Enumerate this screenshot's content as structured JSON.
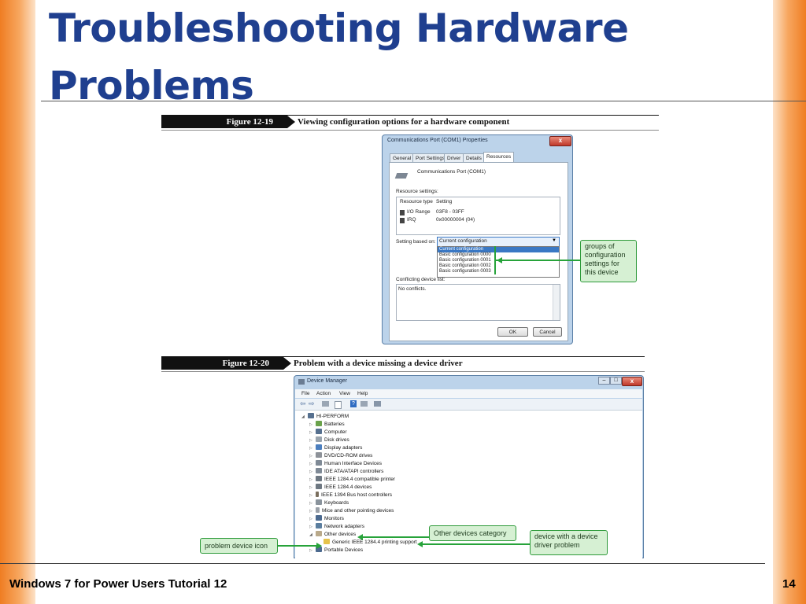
{
  "slide": {
    "title": "Troubleshooting Hardware Problems",
    "footer": "Windows 7 for Power Users Tutorial 12",
    "page_number": "14"
  },
  "figure1": {
    "label": "Figure 12-19",
    "caption": "Viewing configuration options for a hardware component",
    "window": {
      "title": "Communications Port (COM1) Properties",
      "close_label": "x",
      "tabs": [
        "General",
        "Port Settings",
        "Driver",
        "Details",
        "Resources"
      ],
      "active_tab": "Resources",
      "device_name": "Communications Port (COM1)",
      "resource_settings_label": "Resource settings:",
      "table_headers": [
        "Resource type",
        "Setting"
      ],
      "table_rows": [
        {
          "type": "I/O Range",
          "setting": "03F8 - 03FF"
        },
        {
          "type": "IRQ",
          "setting": "0x00000004 (04)"
        }
      ],
      "setting_based_on_label": "Setting based on:",
      "selected_config": "Current configuration",
      "config_options": [
        "Current configuration",
        "Basic configuration 0000",
        "Basic configuration 0001",
        "Basic configuration 0002",
        "Basic configuration 0003"
      ],
      "conflicting_label": "Conflicting device list:",
      "conflicts_text": "No conflicts.",
      "ok_label": "OK",
      "cancel_label": "Cancel"
    },
    "callout": "groups of configuration settings for this device"
  },
  "figure2": {
    "label": "Figure 12-20",
    "caption": "Problem with a device missing a device driver",
    "window": {
      "title": "Device Manager",
      "menu": [
        "File",
        "Action",
        "View",
        "Help"
      ],
      "root": "HI-PERFORM",
      "items": [
        "Batteries",
        "Computer",
        "Disk drives",
        "Display adapters",
        "DVD/CD-ROM drives",
        "Human Interface Devices",
        "IDE ATA/ATAPI controllers",
        "IEEE 1284.4 compatible printer",
        "IEEE 1284.4 devices",
        "IEEE 1394 Bus host controllers",
        "Keyboards",
        "Mice and other pointing devices",
        "Monitors",
        "Network adapters",
        "Other devices"
      ],
      "problem_device": "Generic IEEE 1284.4 printing support",
      "last_item": "Portable Devices"
    },
    "callouts": {
      "other_devices": "Other devices category",
      "problem_icon": "problem device icon",
      "driver_problem": "device with a device driver problem"
    }
  },
  "colors": {
    "title": "#1f3f8f",
    "accent_bar": "#ef7d22",
    "callout_fill": "#d6f0d3",
    "callout_line": "#27a33a"
  }
}
